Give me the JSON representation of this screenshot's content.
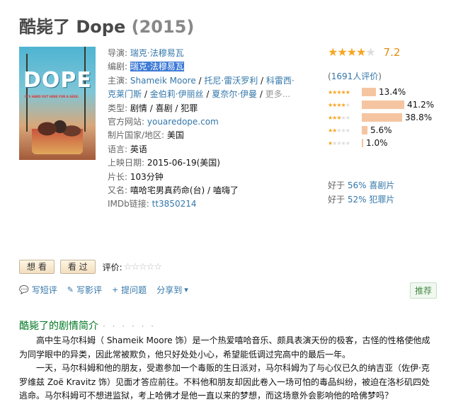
{
  "title": {
    "name": "酷毙了 Dope",
    "year": "(2015)"
  },
  "poster": {
    "headline": "DOPE",
    "tagline": "IT'S HARD OUT HERE FOR A GEEK."
  },
  "info": {
    "director_label": "导演:",
    "director": "瑞克·法穆易瓦",
    "writer_label": "编剧:",
    "writer": "瑞克·法穆易瓦",
    "cast_label": "主演:",
    "cast": [
      "Shameik Moore",
      "托尼·雷沃罗利",
      "科雷西·",
      "克莱门斯",
      "金伯莉·伊丽丝",
      "夏奈尔·伊曼"
    ],
    "cast_more": "更多...",
    "genre_label": "类型:",
    "genres": [
      "剧情",
      "喜剧",
      "犯罪"
    ],
    "site_label": "官方网站:",
    "site": "youaredope.com",
    "country_label": "制片国家/地区:",
    "country": "美国",
    "lang_label": "语言:",
    "lang": "英语",
    "release_label": "上映日期:",
    "release": "2015-06-19(美国)",
    "runtime_label": "片长:",
    "runtime": "103分钟",
    "aka_label": "又名:",
    "aka": "嘻哈宅男真药命(台) / 嗑嗨了",
    "imdb_label": "IMDb链接:",
    "imdb": "tt3850214"
  },
  "rating": {
    "score": "7.2",
    "stars_on": 3.5,
    "votes_open": "(",
    "votes": "1691人评价",
    "votes_close": ")",
    "distribution": [
      {
        "stars": 5,
        "pct": "13.4%",
        "value": 13.4
      },
      {
        "stars": 4,
        "pct": "41.2%",
        "value": 41.2
      },
      {
        "stars": 3,
        "pct": "38.8%",
        "value": 38.8
      },
      {
        "stars": 2,
        "pct": "5.6%",
        "value": 5.6
      },
      {
        "stars": 1,
        "pct": "1.0%",
        "value": 1.0
      }
    ]
  },
  "better_than": [
    {
      "prefix": "好于 ",
      "link": "56% 喜剧片"
    },
    {
      "prefix": "好于 ",
      "link": "52% 犯罪片"
    }
  ],
  "actions": {
    "want": "想 看",
    "seen": "看 过",
    "rate_label": "评价:"
  },
  "links": {
    "short_review": "写短评",
    "review": "写影评",
    "ask": "提问题",
    "share": "分享到",
    "recommend": "推荐"
  },
  "summary": {
    "title": "酷毙了的剧情简介",
    "dots": "· · · · · ·",
    "p1": "高中生马尔科姆（ Shameik Moore 饰）是一个热爱嘻哈音乐、颇具表演天份的极客，古怪的性格使他成为同学眼中的异类，因此常被欺负，他只好处处小心，希望能低调过完高中的最后一年。",
    "p2": "一天，马尔科姆和他的朋友，受邀参加一个毒贩的生日派对，马尔科姆为了与心仪已久的纳吉亚（佐伊·克罗维兹 Zoë Kravitz 饰）见面才答应前往。不料他和朋友却因此卷入一场可怕的毒品纠纷，被迫在洛杉矶四处逃命。马尔科姆可不想进监狱，考上哈佛才是他一直以来的梦想，而这场意外会影响他的哈佛梦吗？"
  }
}
